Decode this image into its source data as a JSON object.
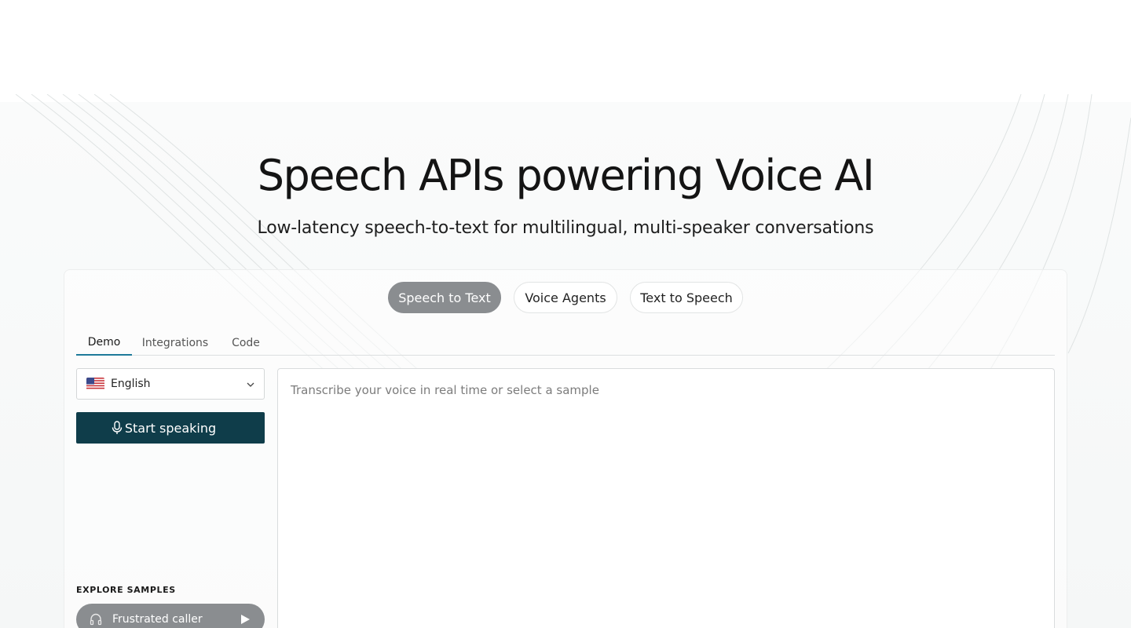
{
  "hero": {
    "headline": "Speech APIs powering Voice AI",
    "subheadline": "Low-latency speech-to-text for multilingual, multi-speaker conversations"
  },
  "product_pills": [
    {
      "label": "Speech to Text",
      "active": true
    },
    {
      "label": "Voice Agents",
      "active": false
    },
    {
      "label": "Text to Speech",
      "active": false
    }
  ],
  "tabs": [
    {
      "label": "Demo",
      "active": true
    },
    {
      "label": "Integrations",
      "active": false
    },
    {
      "label": "Code",
      "active": false
    }
  ],
  "language_select": {
    "value": "English",
    "flag_icon": "us-flag-icon"
  },
  "start_button": {
    "label": "Start speaking",
    "icon": "microphone-icon"
  },
  "transcript": {
    "placeholder": "Transcribe your voice in real time or select a sample"
  },
  "samples": {
    "heading": "EXPLORE SAMPLES",
    "items": [
      {
        "label": "Frustrated caller",
        "icon": "headphones-icon"
      }
    ]
  },
  "colors": {
    "primary_dark": "#0f3d4a",
    "active_pill": "#8a8d90",
    "tab_underline": "#1d7a9a"
  }
}
